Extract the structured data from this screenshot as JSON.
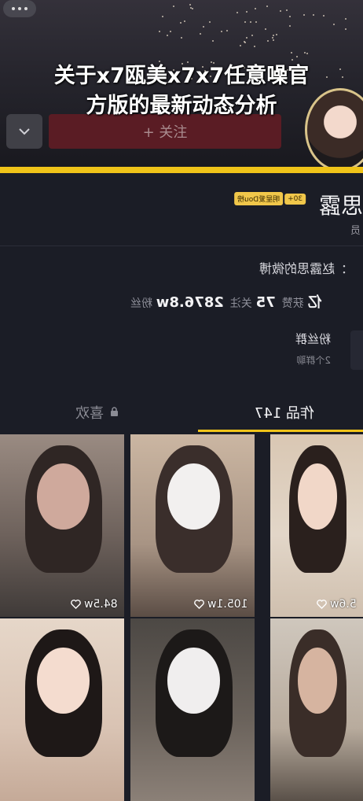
{
  "headline": {
    "line1": "关于x7瓯美x7x7任意噪官",
    "line2": "方版的最新动态分析"
  },
  "header": {
    "follow_label": "+ 关注",
    "more_icon": "more-dots-icon",
    "dropdown_icon": "chevron-down-icon"
  },
  "profile": {
    "name": "思露",
    "badge_1": "30+",
    "badge_2": "明星爱Dou榜",
    "sub_label": "员",
    "signature": "：赵露思的微博",
    "stats": {
      "likes_value": "亿",
      "likes_label": "获赞",
      "following_value": "75",
      "following_label": "关注",
      "followers_value": "2876.8w",
      "followers_label": "粉丝"
    },
    "fans_group": {
      "title": "粉丝群",
      "subtitle": "2个群聊"
    }
  },
  "tabs": {
    "works_label": "作品 147",
    "likes_label": "喜欢",
    "likes_icon": "lock-icon",
    "active": "works"
  },
  "videos": [
    {
      "count": "84.5w"
    },
    {
      "count": "105.1w"
    },
    {
      "count": "5.6w"
    },
    {
      "count": ""
    },
    {
      "count": ""
    },
    {
      "count": ""
    }
  ],
  "colors": {
    "accent": "#f0c419",
    "follow_button": "#5a1c24",
    "background": "#1b1d26"
  }
}
